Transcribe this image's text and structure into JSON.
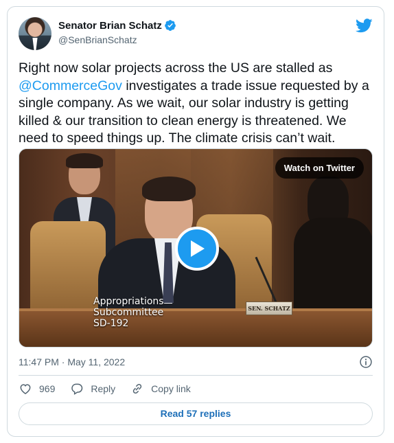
{
  "author": {
    "display_name": "Senator Brian Schatz",
    "handle": "@SenBrianSchatz",
    "verified": true
  },
  "tweet": {
    "text_before": "Right now solar projects across the US are stalled as ",
    "mention": "@CommerceGov",
    "text_after": " investigates a trade issue requested by a single company. As we wait, our solar industry is getting killed & our transition to clean energy is threatened. We need to speed things up. The climate crisis can’t wait."
  },
  "media": {
    "watch_label": "Watch on Twitter",
    "caption_lines": [
      "Appropriations",
      "Subcommittee",
      "SD-192"
    ],
    "nameplate": "SEN. SCHATZ"
  },
  "timestamp": "11:47 PM · May 11, 2022",
  "actions": {
    "like_count": "969",
    "reply_label": "Reply",
    "copy_link_label": "Copy link"
  },
  "read_replies_label": "Read 57 replies",
  "colors": {
    "accent": "#1d9bf0",
    "secondary_text": "#536471",
    "border": "#cfd9de"
  },
  "icons": [
    "verified-badge-icon",
    "twitter-bird-icon",
    "play-icon",
    "info-icon",
    "heart-icon",
    "reply-bubble-icon",
    "link-icon"
  ]
}
